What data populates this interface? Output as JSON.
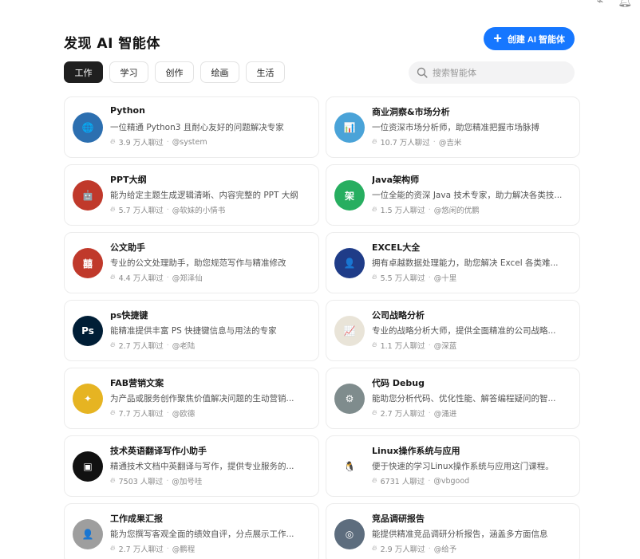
{
  "header": {
    "title": "发现 AI 智能体",
    "create_label": "创建 AI 智能体"
  },
  "tabs": [
    {
      "label": "工作",
      "active": true
    },
    {
      "label": "学习",
      "active": false
    },
    {
      "label": "创作",
      "active": false
    },
    {
      "label": "绘画",
      "active": false
    },
    {
      "label": "生活",
      "active": false
    }
  ],
  "search": {
    "placeholder": "搜索智能体"
  },
  "colors": {
    "accent": "#1677ff",
    "active_tab": "#1f1f1f"
  },
  "cards": [
    {
      "title": "Python",
      "desc": "一位精通 Python3 且耐心友好的问题解决专家",
      "count": "3.9 万人聊过",
      "author": "@system",
      "avatar_icon": "python-globe-icon",
      "avatar_color": "#2c6fb0",
      "avatar_glyph": "🌐"
    },
    {
      "title": "商业洞察&市场分析",
      "desc": "一位资深市场分析师，助您精准把握市场脉搏",
      "count": "10.7 万人聊过",
      "author": "@吉米",
      "avatar_icon": "city-chart-icon",
      "avatar_color": "#4aa3d8",
      "avatar_glyph": "📊"
    },
    {
      "title": "PPT大纲",
      "desc": "能为给定主题生成逻辑清晰、内容完整的 PPT 大纲",
      "count": "5.7 万人聊过",
      "author": "@软妹的小情书",
      "avatar_icon": "robot-icon",
      "avatar_color": "#c0392b",
      "avatar_glyph": "🤖"
    },
    {
      "title": "Java架构师",
      "desc": "一位全能的资深 Java 技术专家，助力解决各类技...",
      "count": "1.5 万人聊过",
      "author": "@悠闲的优鹏",
      "avatar_icon": "architect-badge-icon",
      "avatar_color": "#27ae60",
      "avatar_glyph": "架"
    },
    {
      "title": "公文助手",
      "desc": "专业的公文处理助手，助您规范写作与精准修改",
      "count": "4.4 万人聊过",
      "author": "@郑泽仙",
      "avatar_icon": "seal-icon",
      "avatar_color": "#c0392b",
      "avatar_glyph": "囍"
    },
    {
      "title": "EXCEL大全",
      "desc": "拥有卓越数据处理能力，助您解决 Excel 各类难...",
      "count": "5.5 万人聊过",
      "author": "@十里",
      "avatar_icon": "cyber-head-icon",
      "avatar_color": "#1f3c88",
      "avatar_glyph": "👤"
    },
    {
      "title": "ps快捷键",
      "desc": "能精准提供丰富 PS 快捷键信息与用法的专家",
      "count": "2.7 万人聊过",
      "author": "@老陆",
      "avatar_icon": "photoshop-icon",
      "avatar_color": "#001e36",
      "avatar_glyph": "Ps"
    },
    {
      "title": "公司战略分析",
      "desc": "专业的战略分析大师，提供全面精准的公司战略...",
      "count": "1.1 万人聊过",
      "author": "@深蓝",
      "avatar_icon": "strategy-gauge-icon",
      "avatar_color": "#e9e4d8",
      "avatar_glyph": "📈"
    },
    {
      "title": "FAB营销文案",
      "desc": "为产品或服务创作聚焦价值解决问题的生动营销...",
      "count": "7.7 万人聊过",
      "author": "@欧德",
      "avatar_icon": "marketing-figure-icon",
      "avatar_color": "#e6b422",
      "avatar_glyph": "✦"
    },
    {
      "title": "代码 Debug",
      "desc": "能助您分析代码、优化性能、解答编程疑问的智...",
      "count": "2.7 万人聊过",
      "author": "@涌进",
      "avatar_icon": "debug-gear-icon",
      "avatar_color": "#7f8c8d",
      "avatar_glyph": "⚙"
    },
    {
      "title": "技术英语翻译写作小助手",
      "desc": "精通技术文档中英翻译与写作，提供专业服务的...",
      "count": "7503 人聊过",
      "author": "@加号哇",
      "avatar_icon": "translate-robot-icon",
      "avatar_color": "#111111",
      "avatar_glyph": "▣"
    },
    {
      "title": "Linux操作系统与应用",
      "desc": "便于快速的学习Linux操作系统与应用这门课程。",
      "count": "6731 人聊过",
      "author": "@vbgood",
      "avatar_icon": "penguin-icon",
      "avatar_color": "#ffffff",
      "avatar_glyph": "🐧"
    },
    {
      "title": "工作成果汇报",
      "desc": "能为您撰写客观全面的绩效自评，分点展示工作...",
      "count": "2.7 万人聊过",
      "author": "@鹏程",
      "avatar_icon": "portrait-sketch-icon",
      "avatar_color": "#9e9e9e",
      "avatar_glyph": "👤"
    },
    {
      "title": "竞品调研报告",
      "desc": "能提供精准竞品调研分析报告，涵盖多方面信息",
      "count": "2.9 万人聊过",
      "author": "@给予",
      "avatar_icon": "research-lens-icon",
      "avatar_color": "#5d6d7e",
      "avatar_glyph": "◎"
    }
  ]
}
